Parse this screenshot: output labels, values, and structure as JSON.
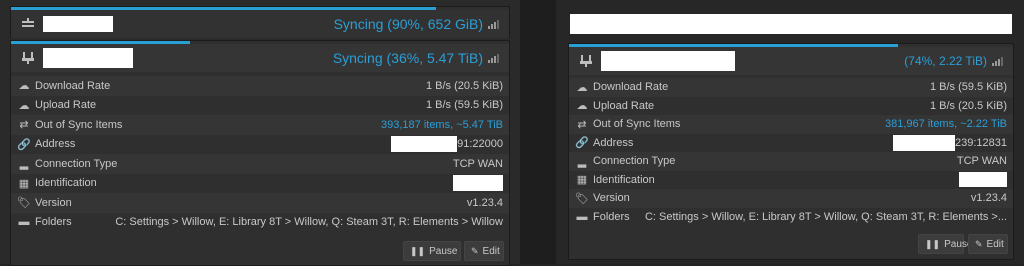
{
  "left": {
    "card1": {
      "status": "Syncing (90%, 652 GiB)",
      "progress_pct": 90
    },
    "card2": {
      "status": "Syncing (36%, 5.47 TiB)",
      "progress_pct": 36,
      "rows": [
        {
          "icon": "cloud-download-icon",
          "label": "Download Rate",
          "value": "1 B/s (20.5 KiB)"
        },
        {
          "icon": "cloud-upload-icon",
          "label": "Upload Rate",
          "value": "1 B/s (59.5 KiB)"
        },
        {
          "icon": "exchange-icon",
          "label": "Out of Sync Items",
          "value": "393,187 items, ~5.47 TiB"
        },
        {
          "icon": "link-icon",
          "label": "Address",
          "value": "91:22000"
        },
        {
          "icon": "signal-icon",
          "label": "Connection Type",
          "value": "TCP WAN"
        },
        {
          "icon": "qrcode-icon",
          "label": "Identification",
          "value": ""
        },
        {
          "icon": "tag-icon",
          "label": "Version",
          "value": "v1.23.4"
        },
        {
          "icon": "folder-icon",
          "label": "Folders",
          "value": "C: Settings > Willow, E: Library 8T > Willow, Q: Steam 3T, R: Elements > Willow"
        }
      ],
      "pause_label": "Pause",
      "edit_label": "Edit"
    }
  },
  "right": {
    "card2": {
      "status": "(74%, 2.22 TiB)",
      "progress_pct": 74,
      "rows": [
        {
          "icon": "cloud-download-icon",
          "label": "Download Rate",
          "value": "1 B/s (59.5 KiB)"
        },
        {
          "icon": "cloud-upload-icon",
          "label": "Upload Rate",
          "value": "1 B/s (20.5 KiB)"
        },
        {
          "icon": "exchange-icon",
          "label": "Out of Sync Items",
          "value": "381,967 items, ~2.22 TiB"
        },
        {
          "icon": "link-icon",
          "label": "Address",
          "value": "239:12831"
        },
        {
          "icon": "signal-icon",
          "label": "Connection Type",
          "value": "TCP WAN"
        },
        {
          "icon": "qrcode-icon",
          "label": "Identification",
          "value": ""
        },
        {
          "icon": "tag-icon",
          "label": "Version",
          "value": "v1.23.4"
        },
        {
          "icon": "folder-icon",
          "label": "Folders",
          "value": "C: Settings > Willow, E: Library 8T > Willow, Q: Steam 3T, R: Elements >..."
        }
      ],
      "pause_label": "Pause",
      "edit_label": "Edit"
    }
  },
  "colors": {
    "accent": "#2a9fd6",
    "panel": "#2f2f2f",
    "text": "#c8c8c8"
  }
}
